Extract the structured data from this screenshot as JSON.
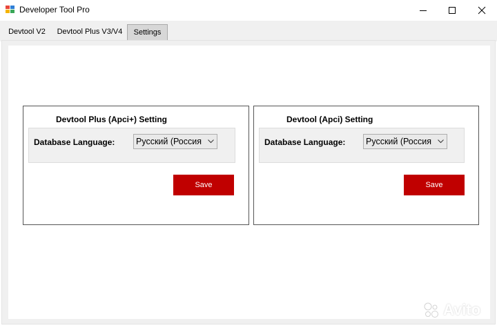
{
  "window": {
    "title": "Developer Tool Pro",
    "controls": [
      "minimize",
      "maximize",
      "close"
    ]
  },
  "tabs": [
    {
      "label": "Devtool V2",
      "active": false
    },
    {
      "label": "Devtool Plus V3/V4",
      "active": false
    },
    {
      "label": "Settings",
      "active": true
    }
  ],
  "groups": [
    {
      "title": "Devtool Plus (Apci+) Setting",
      "language_label": "Database Language:",
      "language_value": "Русский (Россия",
      "save_label": "Save"
    },
    {
      "title": "Devtool (Apci) Setting",
      "language_label": "Database Language:",
      "language_value": "Русский (Россия",
      "save_label": "Save"
    }
  ],
  "colors": {
    "save_button": "#c00000",
    "tab_active": "#d7d7d7",
    "panel_bg": "#f0f0f0"
  },
  "watermark": {
    "text": "Avito"
  }
}
